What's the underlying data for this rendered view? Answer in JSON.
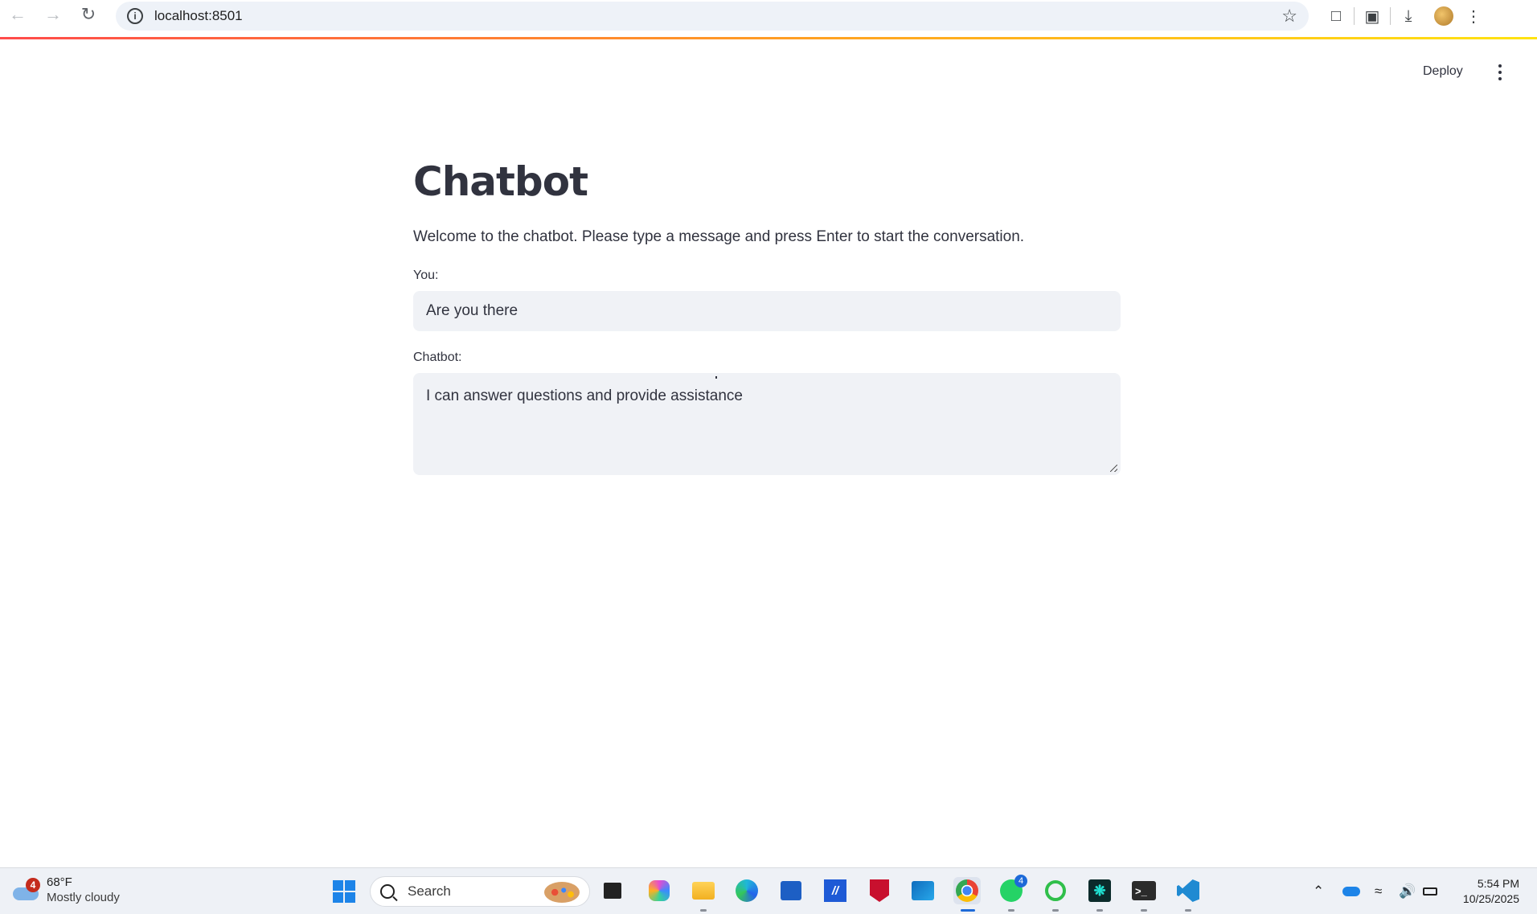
{
  "browser": {
    "url": "localhost:8501"
  },
  "app_header": {
    "deploy_label": "Deploy"
  },
  "main": {
    "title": "Chatbot",
    "welcome": "Welcome to the chatbot. Please type a message and press Enter to start the conversation.",
    "you_label": "You:",
    "you_value": "Are you there",
    "chatbot_label": "Chatbot:",
    "chatbot_value": "I can answer questions and provide assistance"
  },
  "taskbar": {
    "weather_temp": "68°F",
    "weather_condition": "Mostly cloudy",
    "weather_badge": "4",
    "search_label": "Search",
    "whatsapp_badge": "4",
    "time": "5:54 PM",
    "date": "10/25/2025",
    "apps": [
      "task-view",
      "copilot",
      "file-explorer",
      "edge",
      "store",
      "app",
      "mcafee",
      "outlook",
      "chrome",
      "whatsapp",
      "app-green",
      "app-teal",
      "terminal",
      "vscode"
    ]
  },
  "colors": {
    "accent_gradient": [
      "#ff4b4b",
      "#ffa421",
      "#ffe312"
    ],
    "input_bg": "#f0f2f6",
    "text": "#31333f"
  }
}
